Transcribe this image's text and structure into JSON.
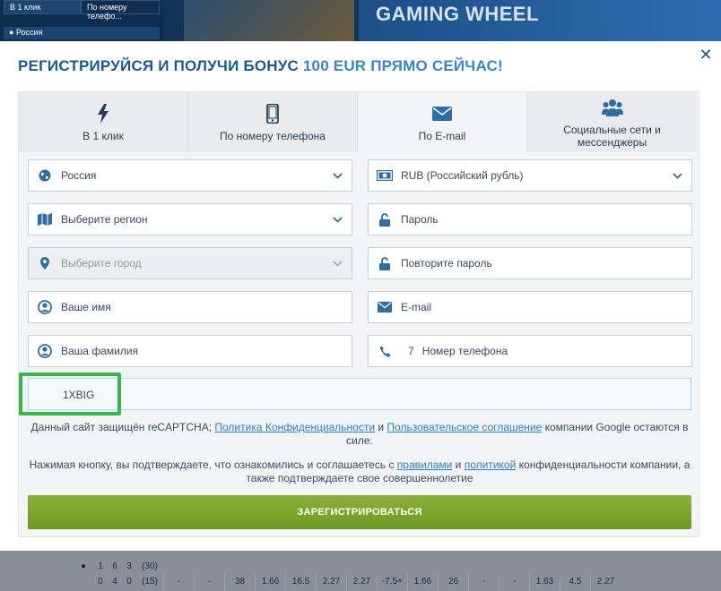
{
  "background": {
    "tab_one_click": "В 1 клик",
    "tab_phone": "По номеру телефо...",
    "country": "Россия",
    "banner_title": "GAMING WHEEL",
    "row1": [
      "1",
      "6",
      "3",
      "(30)"
    ],
    "row2": [
      "0",
      "4",
      "0",
      "(15)",
      "-",
      "-",
      "38",
      "1.66",
      "16.5",
      "2.27",
      "2.27",
      "-7.5+",
      "1.66",
      "26",
      "-",
      "-",
      "1.63",
      "4.5",
      "2.27"
    ]
  },
  "modal": {
    "title_main": "РЕГИСТРИРУЙСЯ И ПОЛУЧИ БОНУС ",
    "title_accent": "100 EUR ПРЯМО СЕЙЧАС!",
    "close": "✕"
  },
  "tabs": [
    {
      "label": "В 1 клик",
      "icon": "lightning-icon"
    },
    {
      "label": "По номеру телефона",
      "icon": "phone-icon"
    },
    {
      "label": "По E-mail",
      "icon": "envelope-icon"
    },
    {
      "label": "Социальные сети и мессенджеры",
      "icon": "users-icon"
    }
  ],
  "fields": {
    "country": "Россия",
    "currency": "RUB (Российский рубль)",
    "region": "Выберите регион",
    "password": "Пароль",
    "city": "Выберите город",
    "repeat_password": "Повторите пароль",
    "first_name": "Ваше имя",
    "email": "E-mail",
    "last_name": "Ваша фамилия",
    "phone_code": "7",
    "phone": "Номер телефона",
    "promo_code": "1XBIG"
  },
  "notice1": {
    "prefix": "Данный сайт защищён reCAPTCHA; ",
    "privacy_link": "Политика Конфиденциальности",
    "and": " и ",
    "terms_link": "Пользовательское соглашение",
    "suffix": " компании Google остаются в силе."
  },
  "notice2": {
    "prefix": "Нажимая кнопку, вы подтверждаете, что ознакомились и соглашаетесь с ",
    "rules_link": "правилами",
    "and": " и ",
    "policy_link": "политикой",
    "suffix": " конфиденциальности компании, а также подтверждаете свое совершеннолетие"
  },
  "register_button": "ЗАРЕГИСТРИРОВАТЬСЯ",
  "colors": {
    "title": "#1a5a8f",
    "accent": "#3a86c8",
    "icon": "#2e6da4",
    "button": "#7aa52c",
    "highlight": "#35b94a"
  }
}
